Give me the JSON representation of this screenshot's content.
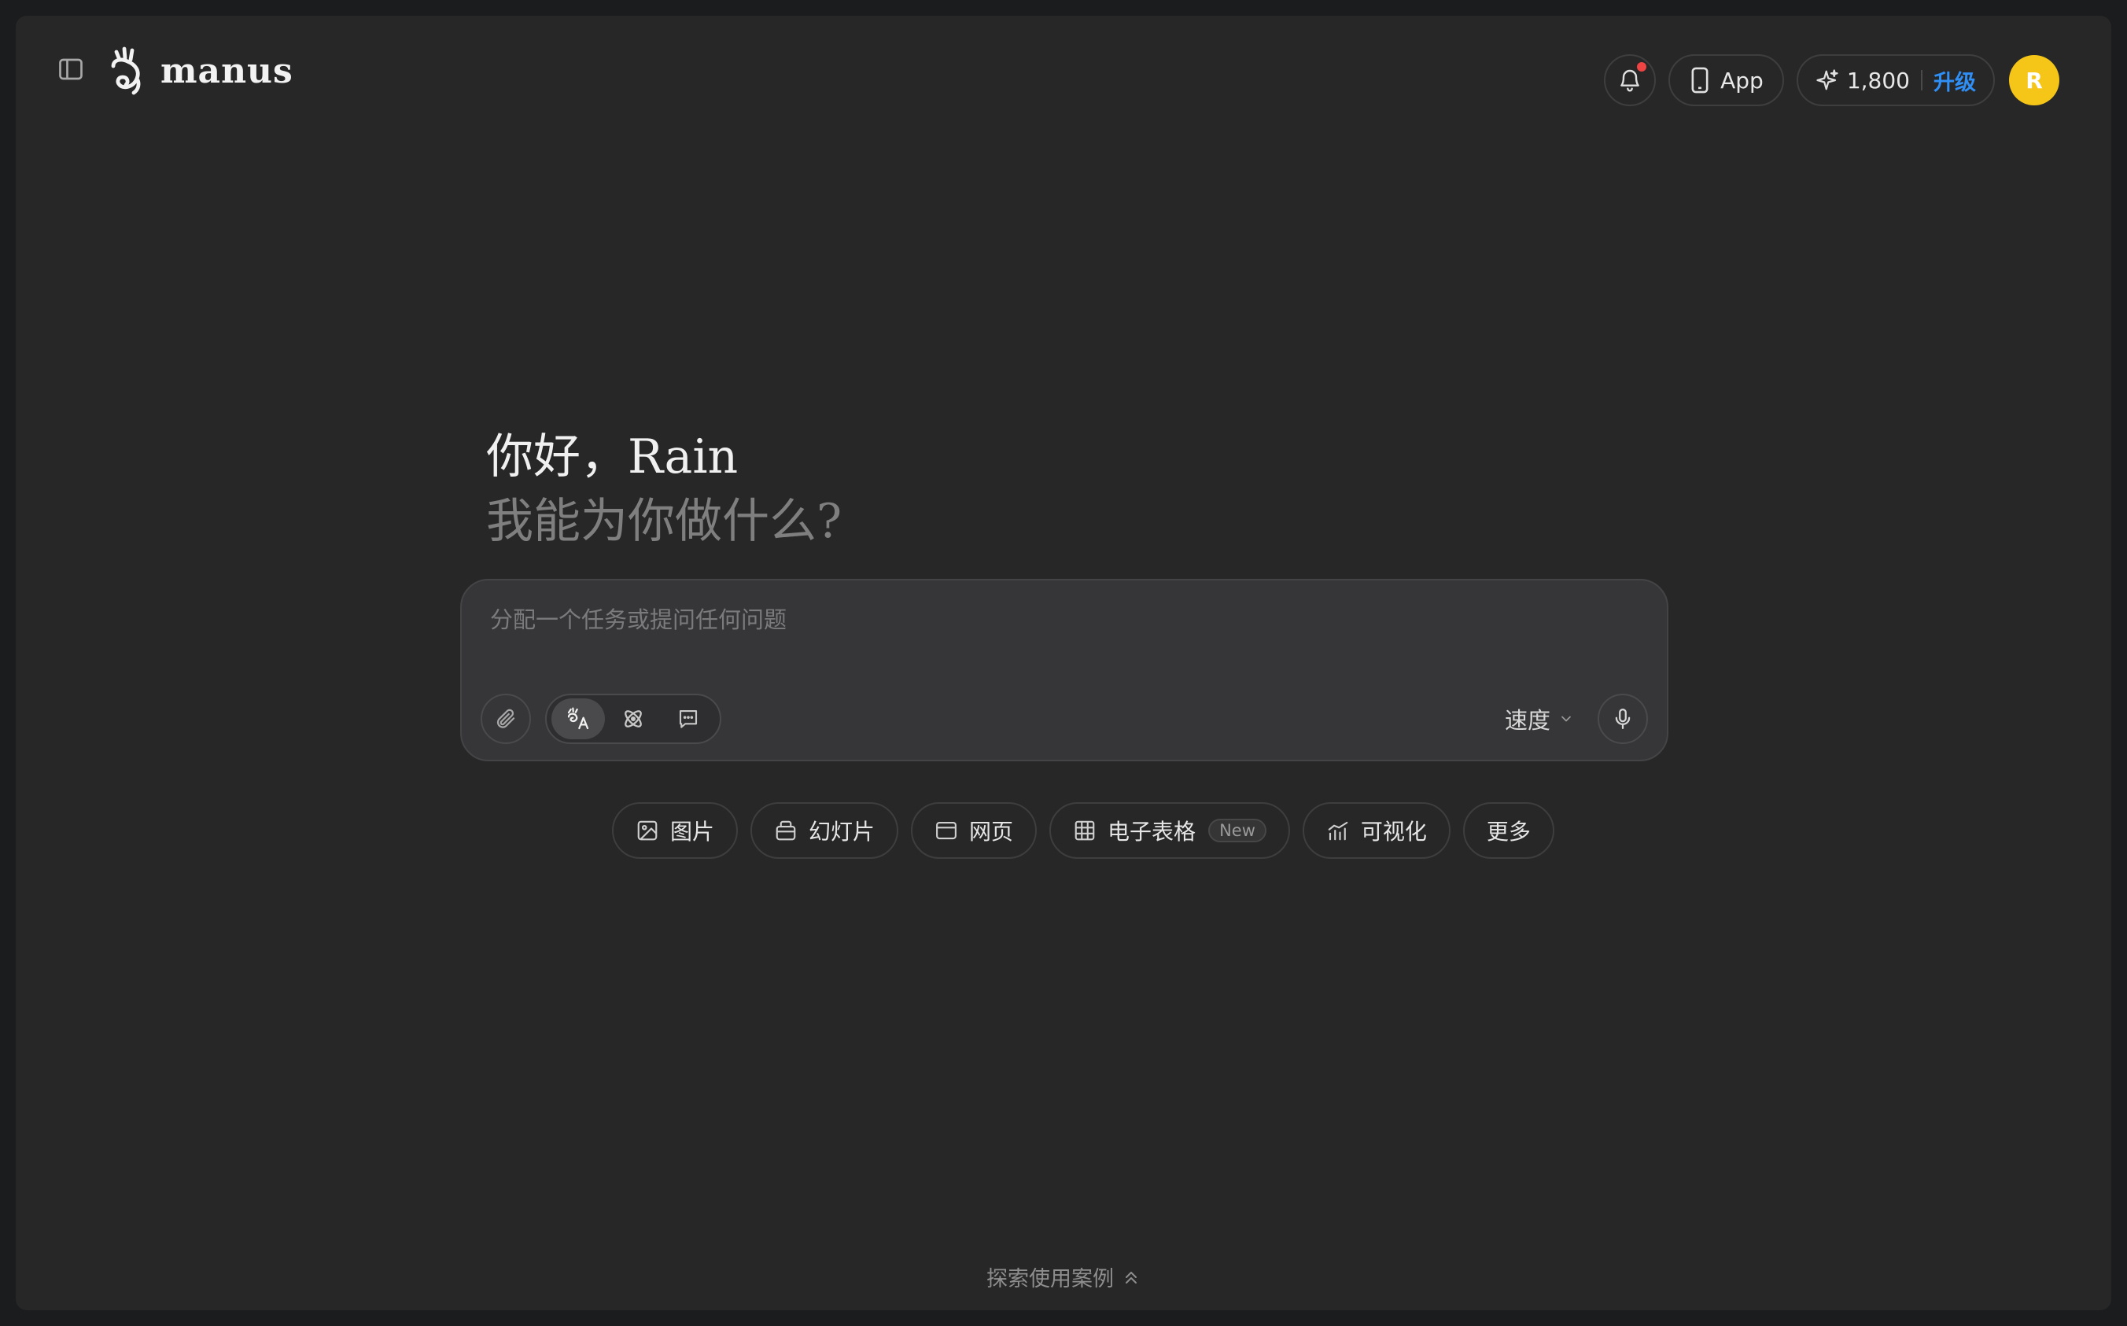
{
  "header": {
    "logo_text": "manus",
    "app_button_label": "App",
    "credits": "1,800",
    "upgrade_label": "升级",
    "avatar_initial": "R",
    "notification_dot_color": "#ef4444",
    "avatar_color": "#f5c518",
    "upgrade_color": "#2f8ff5"
  },
  "greeting": {
    "line1": "你好，Rain",
    "line2": "我能为你做什么?"
  },
  "composer": {
    "placeholder": "分配一个任务或提问任何问题",
    "value": "",
    "speed_label": "速度",
    "modes": [
      {
        "icon": "agent-mode-icon",
        "active": true
      },
      {
        "icon": "atom-icon",
        "active": false
      },
      {
        "icon": "chat-bubble-icon",
        "active": false
      }
    ]
  },
  "chips": [
    {
      "label": "图片",
      "icon": "image-icon"
    },
    {
      "label": "幻灯片",
      "icon": "presentation-icon"
    },
    {
      "label": "网页",
      "icon": "browser-window-icon"
    },
    {
      "label": "电子表格",
      "icon": "table-icon",
      "badge": "New"
    },
    {
      "label": "可视化",
      "icon": "chart-icon"
    },
    {
      "label": "更多",
      "icon": ""
    }
  ],
  "footer": {
    "explore_label": "探索使用案例"
  }
}
